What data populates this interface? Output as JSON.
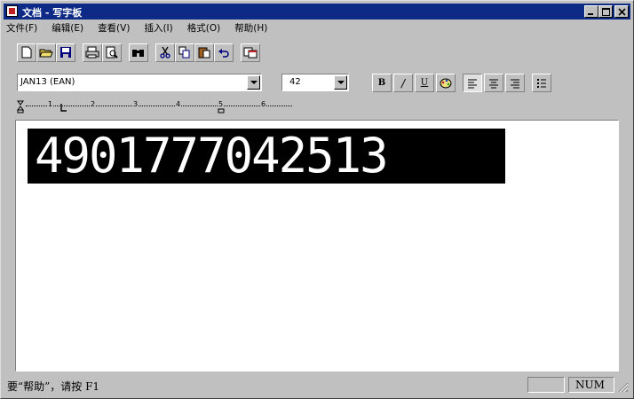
{
  "window": {
    "title": "文档 - 写字板"
  },
  "menu": [
    "文件(F)",
    "编辑(E)",
    "查看(V)",
    "插入(I)",
    "格式(O)",
    "帮助(H)"
  ],
  "toolbar": {
    "icons": [
      "new-document-icon",
      "open-folder-icon",
      "save-disk-icon",
      "print-icon",
      "print-preview-icon",
      "find-binoculars-icon",
      "cut-scissors-icon",
      "copy-icon",
      "paste-icon",
      "undo-icon",
      "date-time-icon"
    ]
  },
  "format": {
    "font_value": "JAN13 (EAN)",
    "size_value": "42",
    "bold_label": "B",
    "italic_label": "/",
    "underline_label": "U"
  },
  "ruler": {
    "marks": [
      "1",
      "2",
      "3",
      "4",
      "5",
      "6"
    ]
  },
  "document": {
    "text": "4901777042513"
  },
  "status": {
    "help_text": "要“帮助”，请按 F1",
    "num_indicator": "NUM"
  },
  "colors": {
    "titlebar": "#0c2a86",
    "face": "#c0c0c0",
    "text_highlight": "#000000"
  }
}
